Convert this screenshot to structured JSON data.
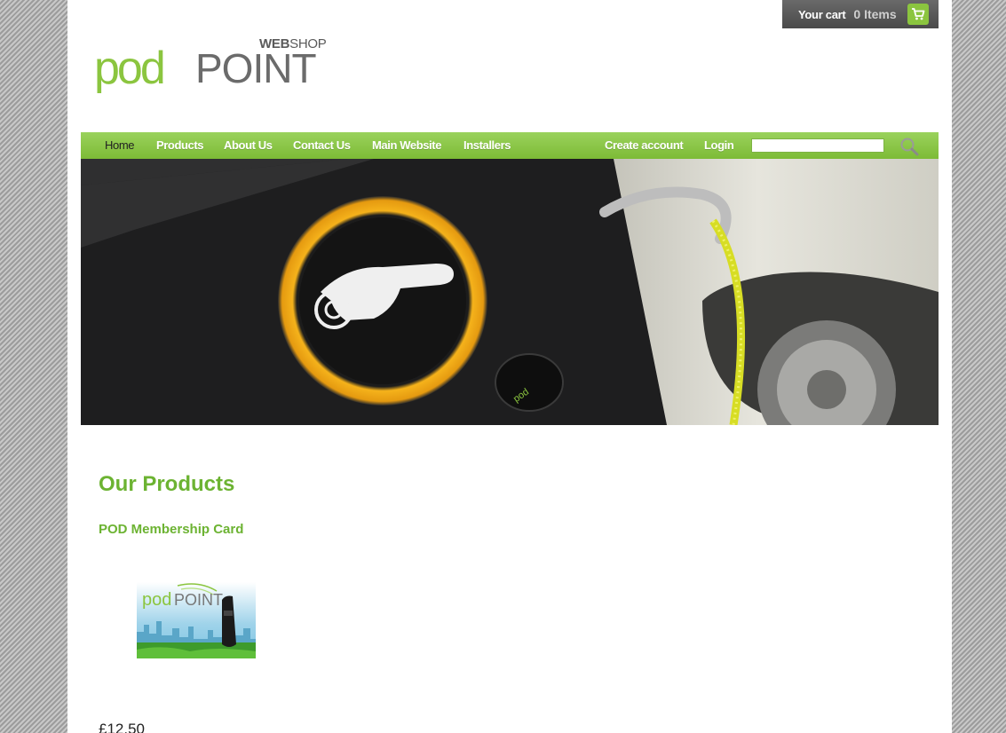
{
  "cart": {
    "label": "Your cart",
    "count": "0 Items",
    "icon": "cart-icon"
  },
  "logo": {
    "pod": "pod",
    "point": "POINT",
    "web": "WEB",
    "shop": "SHOP"
  },
  "nav": {
    "items": [
      {
        "label": "Home",
        "active": true
      },
      {
        "label": "Products"
      },
      {
        "label": "About Us"
      },
      {
        "label": "Contact Us"
      },
      {
        "label": "Main Website"
      },
      {
        "label": "Installers"
      }
    ],
    "account": {
      "create": "Create account",
      "login": "Login"
    },
    "search": {
      "value": "",
      "placeholder": ""
    }
  },
  "content": {
    "section_title": "Our Products",
    "products": [
      {
        "title": "POD Membership Card",
        "price": "£12.50"
      }
    ]
  },
  "colors": {
    "brand_green": "#8bc53f",
    "title_green": "#6cb332",
    "cart_bg": "#555555"
  }
}
